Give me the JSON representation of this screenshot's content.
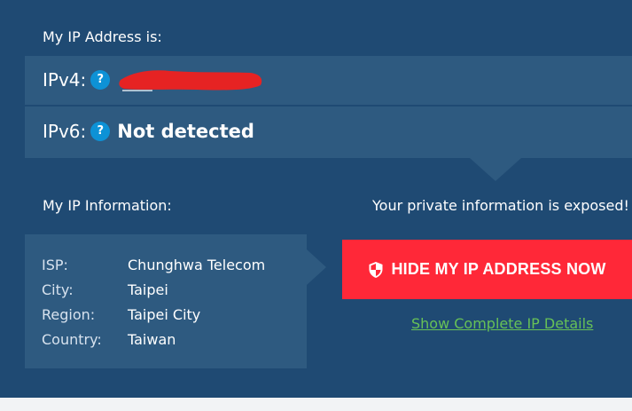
{
  "ip_address_section": {
    "title": "My IP Address is:",
    "ipv4_label": "IPv4:",
    "ipv6_label": "IPv6:",
    "help_symbol": "?",
    "ipv6_value": "Not detected"
  },
  "ip_information": {
    "title": "My IP Information:",
    "rows": [
      {
        "label": "ISP:",
        "value": "Chunghwa Telecom"
      },
      {
        "label": "City:",
        "value": "Taipei"
      },
      {
        "label": "Region:",
        "value": "Taipei City"
      },
      {
        "label": "Country:",
        "value": "Taiwan"
      }
    ]
  },
  "warning": {
    "text": "Your private information is exposed!"
  },
  "actions": {
    "hide_button_label": "HIDE MY IP ADDRESS NOW",
    "details_link_label": "Show Complete IP Details"
  },
  "icons": {
    "help": "question-circle-icon",
    "shield": "shield-icon",
    "redaction": "red-scribble-redaction"
  },
  "colors": {
    "panel_bg": "#1f4a73",
    "box_bg": "#2e5a80",
    "help_icon": "#0d92d6",
    "button_bg": "#ff2838",
    "link": "#67c157",
    "redaction": "#e62323"
  }
}
